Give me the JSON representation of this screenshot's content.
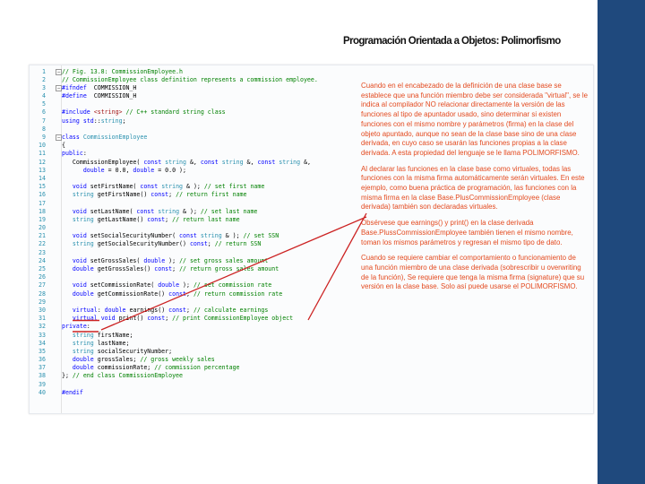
{
  "slide": {
    "title": "Programación Orientada a Objetos: Polimorfismo"
  },
  "code": {
    "lines": [
      {
        "n": "1",
        "parts": [
          [
            "c-com",
            "// Fig. 13.8: CommissionEmployee.h"
          ]
        ]
      },
      {
        "n": "2",
        "parts": [
          [
            "c-com",
            "// CommissionEmployee class definition represents a commission employee."
          ]
        ]
      },
      {
        "n": "3",
        "parts": [
          [
            "c-pp",
            "#ifndef"
          ],
          [
            "",
            "  COMMISSION_H"
          ]
        ]
      },
      {
        "n": "4",
        "parts": [
          [
            "c-pp",
            "#define"
          ],
          [
            "",
            "  COMMISSION_H"
          ]
        ]
      },
      {
        "n": "5",
        "parts": []
      },
      {
        "n": "6",
        "parts": [
          [
            "c-pp",
            "#include"
          ],
          [
            "",
            " "
          ],
          [
            "c-str",
            "<string>"
          ],
          [
            "",
            " "
          ],
          [
            "c-com",
            "// C++ standard string class"
          ]
        ]
      },
      {
        "n": "7",
        "parts": [
          [
            "c-kw",
            "using"
          ],
          [
            "",
            " "
          ],
          [
            "c-kw",
            "std"
          ],
          [
            "",
            "::"
          ],
          [
            "c-ty",
            "string"
          ],
          [
            "",
            ";"
          ]
        ]
      },
      {
        "n": "8",
        "parts": []
      },
      {
        "n": "9",
        "parts": [
          [
            "c-kw",
            "class"
          ],
          [
            "",
            " "
          ],
          [
            "c-ty",
            "CommissionEmployee"
          ]
        ]
      },
      {
        "n": "10",
        "parts": [
          [
            "",
            "{"
          ]
        ]
      },
      {
        "n": "11",
        "parts": [
          [
            "c-kw",
            "public"
          ],
          [
            "",
            ":"
          ]
        ]
      },
      {
        "n": "12",
        "parts": [
          [
            "",
            "   CommissionEmployee( "
          ],
          [
            "c-kw",
            "const"
          ],
          [
            "",
            " "
          ],
          [
            "c-ty",
            "string"
          ],
          [
            "",
            " &, "
          ],
          [
            "c-kw",
            "const"
          ],
          [
            "",
            " "
          ],
          [
            "c-ty",
            "string"
          ],
          [
            "",
            " &, "
          ],
          [
            "c-kw",
            "const"
          ],
          [
            "",
            " "
          ],
          [
            "c-ty",
            "string"
          ],
          [
            "",
            " &,"
          ]
        ]
      },
      {
        "n": "13",
        "parts": [
          [
            "",
            "      "
          ],
          [
            "c-kw",
            "double"
          ],
          [
            "",
            " = 0.0, "
          ],
          [
            "c-kw",
            "double"
          ],
          [
            "",
            " = 0.0 );"
          ]
        ]
      },
      {
        "n": "14",
        "parts": []
      },
      {
        "n": "15",
        "parts": [
          [
            "",
            "   "
          ],
          [
            "c-kw",
            "void"
          ],
          [
            "",
            " setFirstName( "
          ],
          [
            "c-kw",
            "const"
          ],
          [
            "",
            " "
          ],
          [
            "c-ty",
            "string"
          ],
          [
            "",
            " & ); "
          ],
          [
            "c-com",
            "// set first name"
          ]
        ]
      },
      {
        "n": "16",
        "parts": [
          [
            "",
            "   "
          ],
          [
            "c-ty",
            "string"
          ],
          [
            "",
            " getFirstName() "
          ],
          [
            "c-kw",
            "const"
          ],
          [
            "",
            "; "
          ],
          [
            "c-com",
            "// return first name"
          ]
        ]
      },
      {
        "n": "17",
        "parts": []
      },
      {
        "n": "18",
        "parts": [
          [
            "",
            "   "
          ],
          [
            "c-kw",
            "void"
          ],
          [
            "",
            " setLastName( "
          ],
          [
            "c-kw",
            "const"
          ],
          [
            "",
            " "
          ],
          [
            "c-ty",
            "string"
          ],
          [
            "",
            " & ); "
          ],
          [
            "c-com",
            "// set last name"
          ]
        ]
      },
      {
        "n": "19",
        "parts": [
          [
            "",
            "   "
          ],
          [
            "c-ty",
            "string"
          ],
          [
            "",
            " getLastName() "
          ],
          [
            "c-kw",
            "const"
          ],
          [
            "",
            "; "
          ],
          [
            "c-com",
            "// return last name"
          ]
        ]
      },
      {
        "n": "20",
        "parts": []
      },
      {
        "n": "21",
        "parts": [
          [
            "",
            "   "
          ],
          [
            "c-kw",
            "void"
          ],
          [
            "",
            " setSocialSecurityNumber( "
          ],
          [
            "c-kw",
            "const"
          ],
          [
            "",
            " "
          ],
          [
            "c-ty",
            "string"
          ],
          [
            "",
            " & ); "
          ],
          [
            "c-com",
            "// set SSN"
          ]
        ]
      },
      {
        "n": "22",
        "parts": [
          [
            "",
            "   "
          ],
          [
            "c-ty",
            "string"
          ],
          [
            "",
            " getSocialSecurityNumber() "
          ],
          [
            "c-kw",
            "const"
          ],
          [
            "",
            "; "
          ],
          [
            "c-com",
            "// return SSN"
          ]
        ]
      },
      {
        "n": "23",
        "parts": []
      },
      {
        "n": "24",
        "parts": [
          [
            "",
            "   "
          ],
          [
            "c-kw",
            "void"
          ],
          [
            "",
            " setGrossSales( "
          ],
          [
            "c-kw",
            "double"
          ],
          [
            "",
            " ); "
          ],
          [
            "c-com",
            "// set gross sales amount"
          ]
        ]
      },
      {
        "n": "25",
        "parts": [
          [
            "",
            "   "
          ],
          [
            "c-kw",
            "double"
          ],
          [
            "",
            " getGrossSales() "
          ],
          [
            "c-kw",
            "const"
          ],
          [
            "",
            "; "
          ],
          [
            "c-com",
            "// return gross sales amount"
          ]
        ]
      },
      {
        "n": "26",
        "parts": []
      },
      {
        "n": "27",
        "parts": [
          [
            "",
            "   "
          ],
          [
            "c-kw",
            "void"
          ],
          [
            "",
            " setCommissionRate( "
          ],
          [
            "c-kw",
            "double"
          ],
          [
            "",
            " ); "
          ],
          [
            "c-com",
            "// set commission rate"
          ]
        ]
      },
      {
        "n": "28",
        "parts": [
          [
            "",
            "   "
          ],
          [
            "c-kw",
            "double"
          ],
          [
            "",
            " getCommissionRate() "
          ],
          [
            "c-kw",
            "const"
          ],
          [
            "",
            "; "
          ],
          [
            "c-com",
            "// return commission rate"
          ]
        ]
      },
      {
        "n": "29",
        "parts": []
      },
      {
        "n": "30",
        "parts": [
          [
            "",
            "   "
          ],
          [
            "c-kw",
            "virtual"
          ],
          [
            "",
            ": "
          ],
          [
            "c-kw",
            "double"
          ],
          [
            "",
            " earnings() "
          ],
          [
            "c-kw",
            "const"
          ],
          [
            "",
            "; "
          ],
          [
            "c-com",
            "// calculate earnings"
          ]
        ]
      },
      {
        "n": "31",
        "parts": [
          [
            "",
            "   "
          ],
          [
            "c-kw",
            "virtual"
          ],
          [
            "",
            " "
          ],
          [
            "c-kw",
            "void"
          ],
          [
            "",
            " print() "
          ],
          [
            "c-kw",
            "const"
          ],
          [
            "",
            "; "
          ],
          [
            "c-com",
            "// print CommissionEmployee object"
          ]
        ]
      },
      {
        "n": "32",
        "parts": [
          [
            "c-kw",
            "private"
          ],
          [
            "",
            ":"
          ]
        ]
      },
      {
        "n": "33",
        "parts": [
          [
            "",
            "   "
          ],
          [
            "c-ty",
            "string"
          ],
          [
            "",
            " firstName;"
          ]
        ]
      },
      {
        "n": "34",
        "parts": [
          [
            "",
            "   "
          ],
          [
            "c-ty",
            "string"
          ],
          [
            "",
            " lastName;"
          ]
        ]
      },
      {
        "n": "35",
        "parts": [
          [
            "",
            "   "
          ],
          [
            "c-ty",
            "string"
          ],
          [
            "",
            " socialSecurityNumber;"
          ]
        ]
      },
      {
        "n": "36",
        "parts": [
          [
            "",
            "   "
          ],
          [
            "c-kw",
            "double"
          ],
          [
            "",
            " grossSales; "
          ],
          [
            "c-com",
            "// gross weekly sales"
          ]
        ]
      },
      {
        "n": "37",
        "parts": [
          [
            "",
            "   "
          ],
          [
            "c-kw",
            "double"
          ],
          [
            "",
            " commissionRate; "
          ],
          [
            "c-com",
            "// commission percentage"
          ]
        ]
      },
      {
        "n": "38",
        "parts": [
          [
            "",
            "}; "
          ],
          [
            "c-com",
            "// end class CommissionEmployee"
          ]
        ]
      },
      {
        "n": "39",
        "parts": []
      },
      {
        "n": "40",
        "parts": [
          [
            "c-pp",
            "#endif"
          ]
        ]
      }
    ]
  },
  "notes": [
    "Cuando en el encabezado de la definición de una clase base se establece que una función miembro debe ser considerada \"virtual\", se le indica al compilador NO relacionar directamente la versión de las funciones al tipo de apuntador usado, sino determinar si existen funciones con el mismo nombre y parámetros (firma) en la clase del objeto apuntado, aunque no sean de la clase base sino de una clase derivada, en cuyo caso se usarán las funciones propias a la clase derivada. A esta propiedad del lenguaje se le llama POLIMORFISMO.",
    "Al declarar las funciones en la clase base como virtuales, todas las funciones con la misma firma automáticamente serán virtuales. En este ejemplo, como buena práctica de programación, las funciones con la misma firma en la clase Base.PlusCommissionEmployee (clase derivada) también son declaradas virtuales.",
    "Obsérvese que earnings() y print() en la clase derivada Base.PlussCommissionEmployee también tienen el mismo nombre, toman los mismos parámetros y regresan el mismo tipo de dato.",
    "Cuando se requiere cambiar el comportamiento o funcionamiento de una función miembro de una clase derivada (sobrescribir u overwriting de la función), Se requiere que tenga la misma firma (signature) que su versión en la clase base. Solo así puede usarse el POLIMORFISMO."
  ],
  "colors": {
    "note_text": "#e34a1f",
    "sidebar": "#1f497d",
    "arrow": "#cc2222"
  }
}
